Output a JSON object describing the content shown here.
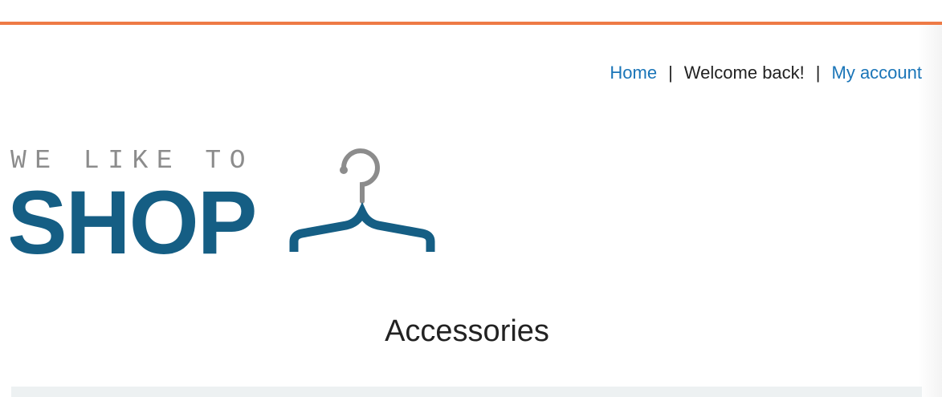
{
  "colors": {
    "accent_bar": "#ee7a45",
    "link": "#1a75b8",
    "text": "#222222",
    "logo_blue": "#155e84",
    "logo_gray": "#8c8c8c",
    "panel_bg": "#edf1f2"
  },
  "nav": {
    "home_label": "Home",
    "separator": "|",
    "welcome_text": "Welcome back!",
    "account_label": "My account"
  },
  "logo": {
    "tagline": "WE LIKE TO",
    "wordmark": "SHOP",
    "icon": "hanger-icon"
  },
  "page": {
    "heading": "Accessories"
  }
}
